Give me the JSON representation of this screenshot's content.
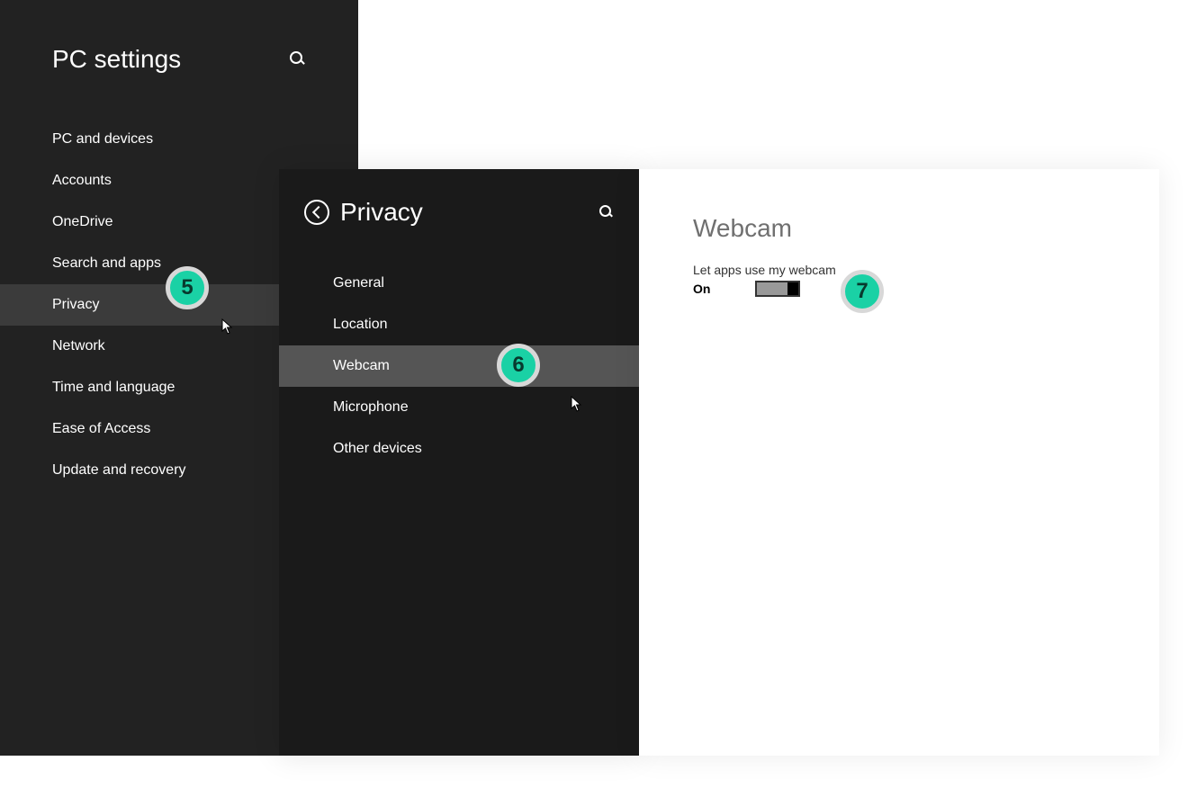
{
  "sidebar": {
    "title": "PC settings",
    "items": [
      {
        "label": "PC and devices"
      },
      {
        "label": "Accounts"
      },
      {
        "label": "OneDrive"
      },
      {
        "label": "Search and apps"
      },
      {
        "label": "Privacy",
        "selected": true
      },
      {
        "label": "Network"
      },
      {
        "label": "Time and language"
      },
      {
        "label": "Ease of Access"
      },
      {
        "label": "Update and recovery"
      }
    ]
  },
  "privacy": {
    "title": "Privacy",
    "items": [
      {
        "label": "General"
      },
      {
        "label": "Location"
      },
      {
        "label": "Webcam",
        "selected": true
      },
      {
        "label": "Microphone"
      },
      {
        "label": "Other devices"
      }
    ]
  },
  "content": {
    "title": "Webcam",
    "setting_label": "Let apps use my webcam",
    "toggle_state": "On"
  },
  "markers": {
    "m5": "5",
    "m6": "6",
    "m7": "7"
  }
}
